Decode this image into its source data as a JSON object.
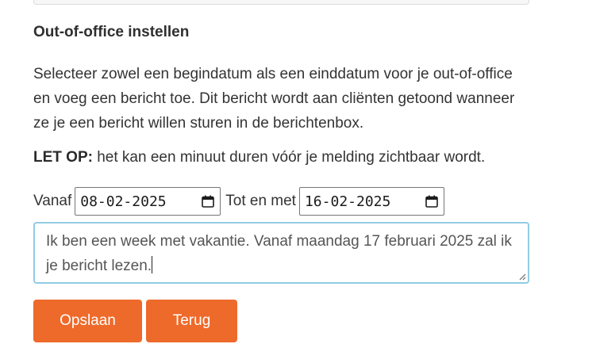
{
  "section": {
    "title": "Out-of-office instellen",
    "description": "Selecteer zowel een begindatum als een einddatum voor je out-of-office en voeg een bericht toe. Dit bericht wordt aan cliënten getoond wanneer ze je een bericht willen sturen in de berichtenbox.",
    "notice_label": "LET OP:",
    "notice_text": " het kan een minuut duren vóór je melding zichtbaar wordt."
  },
  "dates": {
    "from_label": "Vanaf",
    "from_value": "08-02-2025",
    "to_label": "Tot en met",
    "to_value": "16-02-2025"
  },
  "message": {
    "value": "Ik ben een week met vakantie. Vanaf maandag 17 februari 2025 zal ik je bericht lezen."
  },
  "buttons": {
    "save_label": "Opslaan",
    "back_label": "Terug"
  },
  "colors": {
    "button_bg": "#ee6a2a",
    "textarea_focus_border": "#93cbe3"
  },
  "icons": {
    "date_picker": "calendar-icon",
    "textarea_resize": "resize-grip-icon"
  }
}
